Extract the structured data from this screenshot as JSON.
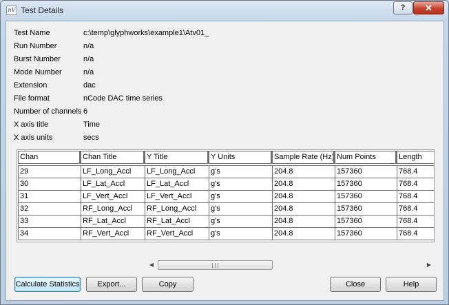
{
  "window": {
    "title": "Test Details",
    "app_icon_glyph": "nV",
    "help_glyph": "?",
    "close_glyph": "✕"
  },
  "info": [
    {
      "label": "Test Name",
      "value": "c:\\temp\\glyphworks\\example1\\Atv01_"
    },
    {
      "label": "Run Number",
      "value": "n/a"
    },
    {
      "label": "Burst Number",
      "value": "n/a"
    },
    {
      "label": "Mode Number",
      "value": "n/a"
    },
    {
      "label": "Extension",
      "value": "dac"
    },
    {
      "label": "File format",
      "value": "nCode DAC time series"
    },
    {
      "label": "Number of channels",
      "value": "6"
    },
    {
      "label": "X axis title",
      "value": "Time"
    },
    {
      "label": "X axis units",
      "value": "secs"
    }
  ],
  "table": {
    "columns": [
      "Chan",
      "Chan Title",
      "Y Title",
      "Y Units",
      "Sample Rate (Hz)",
      "Num Points",
      "Length"
    ],
    "rows": [
      [
        "29",
        "LF_Long_Accl",
        "LF_Long_Accl",
        "g's",
        "204.8",
        "157360",
        "768.4"
      ],
      [
        "30",
        "LF_Lat_Accl",
        "LF_Lat_Accl",
        "g's",
        "204.8",
        "157360",
        "768.4"
      ],
      [
        "31",
        "LF_Vert_Accl",
        "LF_Vert_Accl",
        "g's",
        "204.8",
        "157360",
        "768.4"
      ],
      [
        "32",
        "RF_Long_Accl",
        "RF_Long_Accl",
        "g's",
        "204.8",
        "157360",
        "768.4"
      ],
      [
        "33",
        "RF_Lat_Accl",
        "RF_Lat_Accl",
        "g's",
        "204.8",
        "157360",
        "768.4"
      ],
      [
        "34",
        "RF_Vert_Accl",
        "RF_Vert_Accl",
        "g's",
        "204.8",
        "157360",
        "768.4"
      ]
    ]
  },
  "scrollbar": {
    "left_arrow": "◀",
    "right_arrow": "▶"
  },
  "buttons": {
    "calculate_statistics": "Calculate Statistics",
    "export": "Export...",
    "copy": "Copy",
    "close": "Close",
    "help": "Help"
  },
  "colors": {
    "titlebar": "#c4d6ea",
    "close_button": "#c8432f",
    "dialog_bg": "#f0f0f0",
    "default_button_border": "#3c7fb1"
  }
}
